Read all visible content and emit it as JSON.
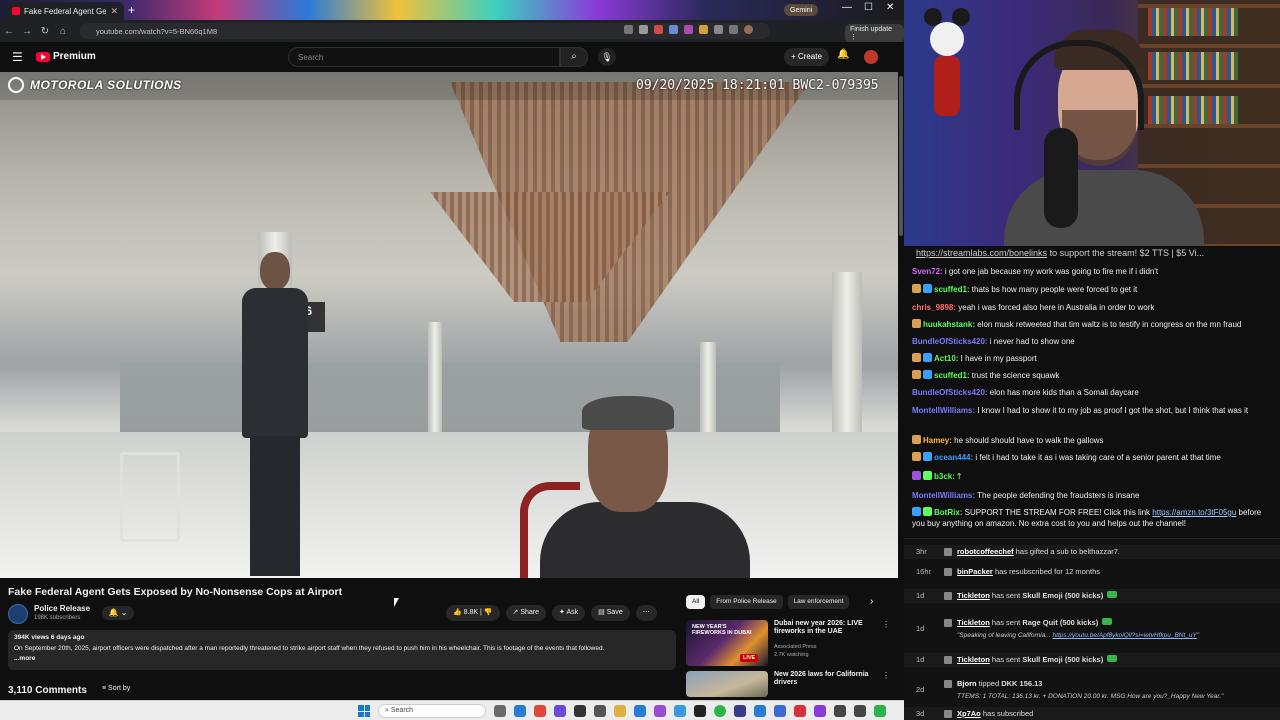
{
  "browser": {
    "tab_title": "Fake Federal Agent Gets Ex",
    "url": "youtube.com/watch?v=5-BN66q1M8",
    "gemini_label": "Gemini",
    "finish_update_label": "Finish update"
  },
  "youtube": {
    "premium_label": "Premium",
    "search_placeholder": "Search",
    "create_label": "Create",
    "video": {
      "brand_text": "MOTOROLA SOLUTIONS",
      "timestamp": "09/20/2025 18:21:01 BWC2-079395",
      "gate_sign": "T6"
    },
    "title": "Fake Federal Agent Gets Exposed by No-Nonsense Cops at Airport",
    "channel": {
      "name": "Police Release",
      "subscribers": "198K subscribers"
    },
    "actions": {
      "likes": "8.8K",
      "share": "Share",
      "ask": "Ask",
      "save": "Save"
    },
    "description": {
      "meta": "394K views  6 days ago",
      "text": "On September 20th, 2025, airport officers were dispatched after a man reportedly threatened to strike airport staff when they refused to push him in his wheelchair. This is footage of the events that followed.",
      "more": "...more"
    },
    "comments_count": "3,110 Comments",
    "sort_label": "Sort by",
    "chips": [
      "All",
      "From Police Release",
      "Law enforcement"
    ],
    "recommendations": [
      {
        "title": "Dubai new year 2026: LIVE fireworks in the UAE",
        "channel": "Associated Press",
        "meta": "2.7K watching",
        "badge": "LIVE",
        "thumb_text": "NEW YEAR'S FIREWORKS IN DUBAI"
      },
      {
        "title": "New 2026 laws for California drivers",
        "channel": "",
        "meta": ""
      }
    ]
  },
  "taskbar": {
    "search_label": "Search"
  },
  "stream": {
    "marquee_link": "https://streamlabs.com/bonelinks",
    "marquee_text": " to support the stream! $2 TTS | $5 Vi...",
    "chat": [
      {
        "user": "Sven72:",
        "text": " i got one jab because my work was going to fire me if i didn't",
        "color": "#d46aff"
      },
      {
        "user": "scuffed1:",
        "text": " thats bs how many people were forced to get it",
        "color": "#5cff5c"
      },
      {
        "user": "chris_9898:",
        "text": " yeah i was forced also here in Australia in order to work",
        "color": "#ff7070"
      },
      {
        "user": "huukahstank:",
        "text": " elon musk retweeted that tim waltz is to testify in congress on the mn fraud",
        "color": "#5cff5c"
      },
      {
        "user": "BundleOfSticks420:",
        "text": " i never had to show one",
        "color": "#7a7aff"
      },
      {
        "user": "Act10:",
        "text": " I have in my passport",
        "color": "#5cff5c"
      },
      {
        "user": "scuffed1:",
        "text": " trust the science squawk",
        "color": "#5cff5c"
      },
      {
        "user": "BundleOfSticks420:",
        "text": " elon has more kids than a Somali daycare",
        "color": "#7a7aff"
      },
      {
        "user": "MontellWilliams:",
        "text": " I know I had to show it to my job as proof I got the shot, but I think that was it",
        "color": "#7a7aff"
      },
      {
        "user": "Hamey:",
        "text": " he should should have to walk the gallows",
        "color": "#ffb347"
      },
      {
        "user": "ocean444:",
        "text": " i felt i had to take it as i was taking care of a senior parent at that time",
        "color": "#3aa0ff"
      },
      {
        "user": "b3ck:",
        "text": "",
        "color": "#5cff5c"
      },
      {
        "user": "MontellWilliams:",
        "text": " The people defending the fraudsters is insane",
        "color": "#7a7aff"
      },
      {
        "user": "BotRix:",
        "text": " SUPPORT THE STREAM FOR FREE! Click this link ",
        "link": "https://amzn.to/3tF05gu",
        "text2": " before you buy anything on amazon. No extra cost to you and helps out the channel!",
        "color": "#5cff5c"
      }
    ],
    "events": [
      {
        "time": "3hr",
        "user": "robotcoffeechef",
        "text": " has gifted a sub to ",
        "target": "belthazzar7."
      },
      {
        "time": "16hr",
        "user": "binPacker",
        "text": " has resubscribed for 12 months",
        "target": ""
      },
      {
        "time": "1d",
        "user": "Tickleton",
        "text": " has sent ",
        "target": "Skull Emoji (500 kicks)"
      },
      {
        "time": "1d",
        "user": "Tickleton",
        "text": " has sent ",
        "target": "Rage Quit (500 kicks)",
        "sub": "\"Speaking of leaving California... ",
        "sub_link": "https://youtu.be/Apf8ykolQll?si=ietvHfkpu_BNt_uY",
        "sub_end": "\""
      },
      {
        "time": "1d",
        "user": "Tickleton",
        "text": " has sent ",
        "target": "Skull Emoji (500 kicks)"
      },
      {
        "time": "2d",
        "user": "Bjorn",
        "text": " tipped ",
        "target": "DKK 156.13",
        "sub": "TTEMS: 1 TOTAL: 136.13 kr. + DONATION 20.00 kr. MSG:How are you?_Happy New Year.\""
      },
      {
        "time": "3d",
        "user": "Xp7Ao",
        "text": " has subscribed",
        "target": ""
      }
    ]
  }
}
